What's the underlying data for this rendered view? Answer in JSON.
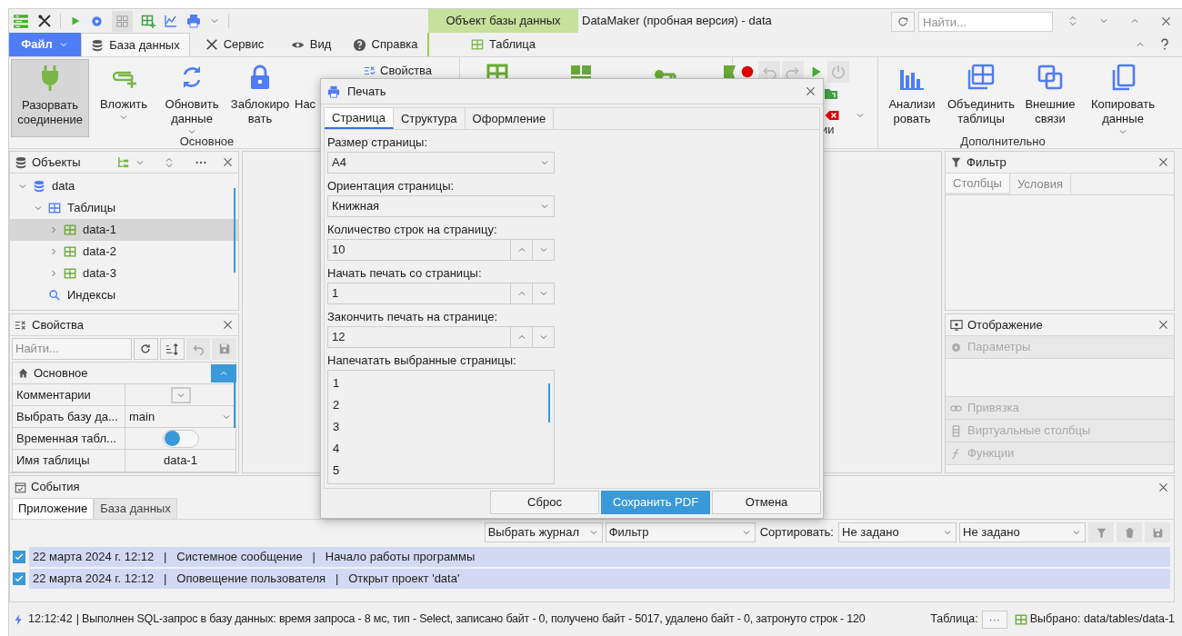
{
  "window": {
    "title": "DataMaker (пробная версия) - data"
  },
  "context_tab": {
    "group": "Объект базы данных",
    "tab": "Таблица"
  },
  "search": {
    "placeholder": "Найти..."
  },
  "file_menu": {
    "label": "Файл"
  },
  "tabs": [
    {
      "label": "База данных",
      "selected": true
    },
    {
      "label": "Сервис",
      "selected": false
    },
    {
      "label": "Вид",
      "selected": false
    },
    {
      "label": "Справка",
      "selected": false
    }
  ],
  "ribbon": {
    "groups": [
      {
        "label": "Основное",
        "buttons": [
          {
            "lines": [
              "Разорвать",
              "соединение"
            ],
            "pressed": true,
            "dropdown": false
          },
          {
            "lines": [
              "Вложить"
            ],
            "pressed": false,
            "dropdown": true
          },
          {
            "lines": [
              "Обновить",
              "данные"
            ],
            "pressed": false,
            "dropdown": true
          },
          {
            "lines": [
              "Заблокиро",
              "вать"
            ],
            "pressed": false,
            "dropdown": false
          },
          {
            "lines": [
              "Нас"
            ],
            "pressed": false,
            "dropdown": false
          }
        ],
        "small_buttons": [
          "Свойства"
        ]
      },
      {
        "label": "ии"
      },
      {
        "label": "Дополнительно",
        "buttons": [
          {
            "lines": [
              "Анализи",
              "ровать"
            ],
            "pressed": false,
            "dropdown": false
          },
          {
            "lines": [
              "Объединить",
              "таблицы"
            ],
            "pressed": false,
            "dropdown": false
          },
          {
            "lines": [
              "Внешние",
              "связи"
            ],
            "pressed": false,
            "dropdown": false
          },
          {
            "lines": [
              "Копировать",
              "данные"
            ],
            "pressed": false,
            "dropdown": true
          }
        ]
      }
    ]
  },
  "objects_panel": {
    "title": "Объекты",
    "tree": [
      {
        "label": "data",
        "kind": "database",
        "expanded": true,
        "selected": false,
        "children": [
          {
            "label": "Таблицы",
            "kind": "tables",
            "expanded": true,
            "selected": false,
            "children": [
              {
                "label": "data-1",
                "kind": "table",
                "expanded": false,
                "selected": true
              },
              {
                "label": "data-2",
                "kind": "table",
                "expanded": false,
                "selected": false
              },
              {
                "label": "data-3",
                "kind": "table",
                "expanded": false,
                "selected": false
              }
            ]
          },
          {
            "label": "Индексы",
            "kind": "indexes",
            "selected": false
          }
        ]
      }
    ]
  },
  "properties_panel": {
    "title": "Свойства",
    "search_placeholder": "Найти...",
    "category": {
      "label": "Основное",
      "expanded": true
    },
    "rows": [
      {
        "name": "Комментарии",
        "kind": "dropdown-button"
      },
      {
        "name": "Выбрать базу да...",
        "kind": "select",
        "value": "main"
      },
      {
        "name": "Временная табл...",
        "kind": "toggle",
        "on": false
      },
      {
        "name": "Имя таблицы",
        "kind": "text",
        "value": "data-1"
      }
    ]
  },
  "filter_panel": {
    "title": "Фильтр",
    "tabs": [
      {
        "label": "Столбцы",
        "selected": true
      },
      {
        "label": "Условия",
        "selected": false
      }
    ]
  },
  "display_panel": {
    "title": "Отображение",
    "sections": [
      {
        "label": "Параметры",
        "disabled": true
      },
      {
        "label": "Привязка",
        "disabled": true
      },
      {
        "label": "Виртуальные столбцы",
        "disabled": true
      },
      {
        "label": "Функции",
        "disabled": true
      }
    ]
  },
  "events_panel": {
    "title": "События",
    "tabs": [
      {
        "label": "Приложение",
        "selected": true
      },
      {
        "label": "База данных",
        "selected": false
      }
    ],
    "separator": "|",
    "journal": "Выбрать журнал",
    "filter": "Фильтр",
    "sort_label": "Сортировать:",
    "sort_1": "Не задано",
    "sort_2": "Не задано",
    "rows": [
      {
        "checked": true,
        "date": "22 марта 2024 г. 12:12",
        "type": "Системное сообщение",
        "message": "Начало работы программы"
      },
      {
        "checked": true,
        "date": "22 марта 2024 г. 12:12",
        "type": "Оповещение пользователя",
        "message": "Открыт проект 'data'"
      }
    ]
  },
  "status_bar": {
    "time": "12:12:42",
    "message": "| Выполнен SQL-запрос в базу данных: время запроса - 8 мс, тип - Select, записано байт - 0, получено байт - 5017, удалено байт - 0, затронуто строк - 120",
    "table_label": "Таблица:",
    "table_button": "···",
    "selection": "Выбрано: data/tables/data-1"
  },
  "dialog": {
    "title": "Печать",
    "tabs": [
      {
        "label": "Страница",
        "selected": true
      },
      {
        "label": "Структура",
        "selected": false
      },
      {
        "label": "Оформление",
        "selected": false
      }
    ],
    "fields": [
      {
        "label": "Размер страницы:",
        "kind": "select",
        "value": "A4"
      },
      {
        "label": "Ориентация страницы:",
        "kind": "select",
        "value": "Книжная"
      },
      {
        "label": "Количество строк на страницу:",
        "kind": "spin",
        "value": "10"
      },
      {
        "label": "Начать печать со страницы:",
        "kind": "spin",
        "value": "1"
      },
      {
        "label": "Закончить печать на странице:",
        "kind": "spin",
        "value": "12"
      },
      {
        "label": "Напечатать выбранные страницы:",
        "kind": "list",
        "items": [
          "1",
          "2",
          "3",
          "4",
          "5"
        ]
      }
    ],
    "buttons": [
      {
        "label": "Сброс",
        "primary": false
      },
      {
        "label": "Сохранить PDF",
        "primary": true
      },
      {
        "label": "Отмена",
        "primary": false
      }
    ]
  }
}
